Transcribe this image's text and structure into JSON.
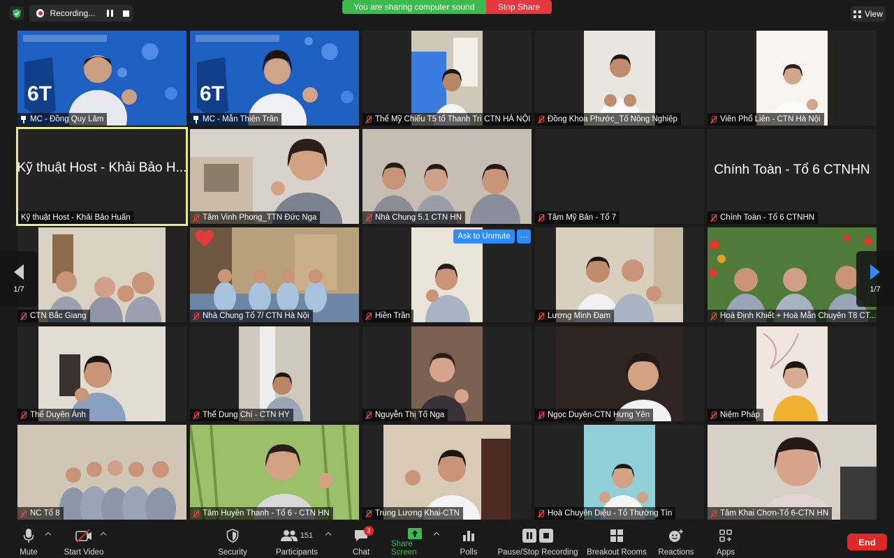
{
  "topbar": {
    "recording_label": "Recording...",
    "sharing_text": "You are sharing computer sound",
    "stop_share_label": "Stop Share",
    "view_label": "View"
  },
  "participants": [
    {
      "name": "MC - Đồng Quy Lâm",
      "icon": "pin-icon"
    },
    {
      "name": "MC - Mẫn Thiện Trân",
      "icon": "pin-icon"
    },
    {
      "name": "Thể Mỹ Chiếu T5 tổ Thanh Trì CTN HÀ NỘI",
      "icon": "mic-off-icon"
    },
    {
      "name": "Đồng Khoa Phước_Tổ Nông Nghiệp",
      "icon": "mic-off-icon"
    },
    {
      "name": "Viên Phổ Liên - CTN Hà Nội",
      "icon": "mic-off-icon"
    },
    {
      "name": "Kỹ thuật Host - Khải Bảo Huấn",
      "big": "Kỹ thuật Host - Khải Bảo H...",
      "icon": "none"
    },
    {
      "name": "Tâm Vinh Phong_TTN Đức Nga",
      "icon": "mic-off-icon"
    },
    {
      "name": "Nhà Chung 5.1 CTN HN",
      "icon": "mic-off-icon"
    },
    {
      "name": "Tâm Mỹ Bản - Tổ 7",
      "icon": "mic-off-icon"
    },
    {
      "name": "Chính Toàn - Tổ 6 CTNHN",
      "big": "Chính Toàn - Tổ 6 CTNHN",
      "icon": "mic-off-icon"
    },
    {
      "name": "CTN Bắc Giang",
      "icon": "mic-off-icon"
    },
    {
      "name": "Nhà Chung Tổ 7/ CTN Hà Nội",
      "icon": "mic-off-icon"
    },
    {
      "name": "Hiền Trần",
      "icon": "mic-off-icon"
    },
    {
      "name": "Lương Minh Đạm",
      "icon": "mic-off-icon"
    },
    {
      "name": "Hoà Định Khiết + Hoà Mẫn Chuyên T8 CT...",
      "icon": "mic-off-icon"
    },
    {
      "name": "Thể Duyên Ánh",
      "icon": "mic-off-icon"
    },
    {
      "name": "Thể Dung Chí - CTN HY",
      "icon": "mic-off-icon"
    },
    {
      "name": "Nguyễn Thị Tố Nga",
      "icon": "mic-off-icon"
    },
    {
      "name": "Ngọc Duyên-CTN Hưng Yên",
      "icon": "mic-off-icon"
    },
    {
      "name": "Niệm Pháp",
      "icon": "mic-off-icon"
    },
    {
      "name": "NC Tổ 8",
      "icon": "mic-off-icon"
    },
    {
      "name": "Tâm Huyền Thanh - Tổ 6 - CTN HN",
      "icon": "mic-off-icon"
    },
    {
      "name": "Trung Lương Khai-CTN",
      "icon": "mic-off-icon"
    },
    {
      "name": "Hoà Chuyên Diệu - Tổ Thường Tín",
      "icon": "mic-off-icon"
    },
    {
      "name": "Tâm Khai Chơn-Tổ 6-CTN HN",
      "icon": "mic-off-icon"
    }
  ],
  "ask_to_unmute_label": "Ask to Unmute",
  "more_label": "···",
  "pagination": {
    "left": "1/7",
    "right": "1/7"
  },
  "toolbar": {
    "mute": "Mute",
    "start_video": "Start Video",
    "security": "Security",
    "participants": "Participants",
    "participants_count": "151",
    "chat": "Chat",
    "chat_badge": "3",
    "share_screen": "Share Screen",
    "polls": "Polls",
    "pause_stop_recording": "Pause/Stop Recording",
    "breakout_rooms": "Breakout Rooms",
    "reactions": "Reactions",
    "apps": "Apps",
    "end": "End"
  },
  "colors": {
    "accent_blue": "#2d8cff",
    "share_green": "#3dba4e",
    "stop_red": "#e5393f",
    "end_red": "#e02828",
    "active_speaker": "#e6ec8c"
  }
}
